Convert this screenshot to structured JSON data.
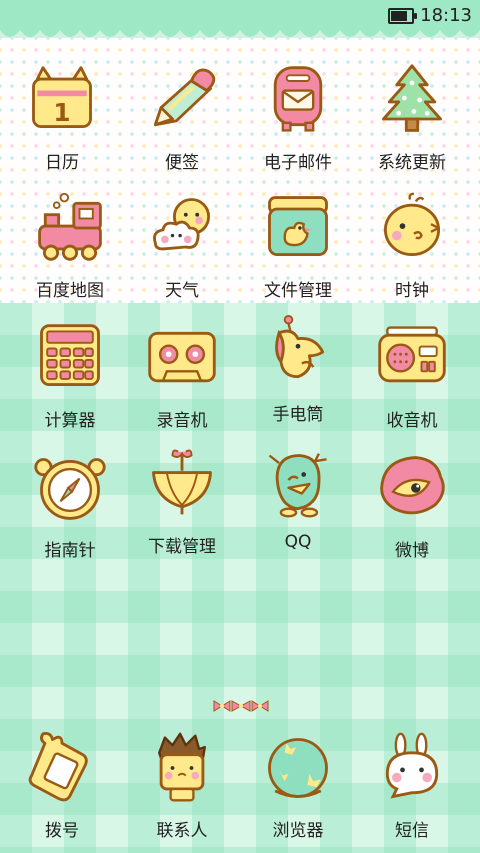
{
  "status_bar": {
    "time": "18:13",
    "battery_level": 0.9
  },
  "apps": [
    {
      "label": "日历",
      "icon": "calendar-icon",
      "calendar_day": "1"
    },
    {
      "label": "便签",
      "icon": "pencil-icon"
    },
    {
      "label": "电子邮件",
      "icon": "mailbox-icon"
    },
    {
      "label": "系统更新",
      "icon": "tree-icon"
    },
    {
      "label": "百度地图",
      "icon": "train-icon"
    },
    {
      "label": "天气",
      "icon": "sun-cloud-icon"
    },
    {
      "label": "文件管理",
      "icon": "jar-icon"
    },
    {
      "label": "时钟",
      "icon": "chick-icon"
    },
    {
      "label": "计算器",
      "icon": "calculator-icon"
    },
    {
      "label": "录音机",
      "icon": "cassette-icon"
    },
    {
      "label": "手电筒",
      "icon": "bird-icon"
    },
    {
      "label": "收音机",
      "icon": "radio-icon"
    },
    {
      "label": "指南针",
      "icon": "compass-icon"
    },
    {
      "label": "下载管理",
      "icon": "umbrella-icon"
    },
    {
      "label": "QQ",
      "icon": "penguin-icon"
    },
    {
      "label": "微博",
      "icon": "eye-icon"
    }
  ],
  "dock": [
    {
      "label": "拨号",
      "icon": "phone-icon"
    },
    {
      "label": "联系人",
      "icon": "boy-icon"
    },
    {
      "label": "浏览器",
      "icon": "globe-icon"
    },
    {
      "label": "短信",
      "icon": "bunny-icon"
    }
  ],
  "colors": {
    "outline": "#9a5a14",
    "pink": "#f28aa4",
    "yellow": "#ffe98a",
    "mint": "#8ddfbf",
    "mint_dark": "#52c79a"
  }
}
